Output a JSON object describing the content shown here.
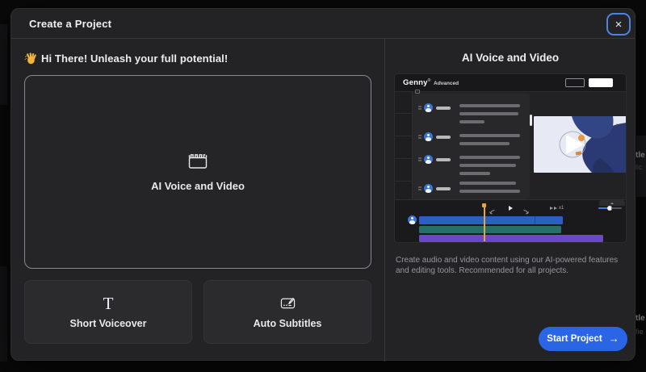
{
  "modal": {
    "title": "Create a Project",
    "close_icon": "×"
  },
  "left_panel": {
    "greeting": "Hi There! Unleash your full potential!",
    "greeting_icon": "waving-hand-emoji",
    "primary_card": {
      "label": "AI Voice and Video",
      "icon": "clapperboard"
    },
    "secondary_cards": [
      {
        "label": "Short Voiceover",
        "icon": "T"
      },
      {
        "label": "Auto Subtitles",
        "icon": "subtitles-edit"
      }
    ]
  },
  "right_panel": {
    "heading": "AI Voice and Video",
    "description": "Create audio and video content using our AI-powered features and editing tools. Recommended for all projects.",
    "start_button": {
      "label": "Start Project",
      "arrow": "→"
    },
    "app_preview": {
      "logo": "Genny",
      "logo_mark": "®",
      "mode_label": "Advanced",
      "playback_speed": "x1"
    }
  },
  "background_fragments": {
    "texts": [
      "tle",
      "lic",
      "tle",
      "fie"
    ]
  },
  "colors": {
    "accent_blue": "#2a65e5",
    "focus_ring": "#4f83e1",
    "track_blue": "#2d5fc0",
    "track_teal": "#27706a",
    "track_purple": "#6a49c8",
    "playhead_orange": "#e8a33d",
    "avatar_blue": "#3b74d8"
  }
}
